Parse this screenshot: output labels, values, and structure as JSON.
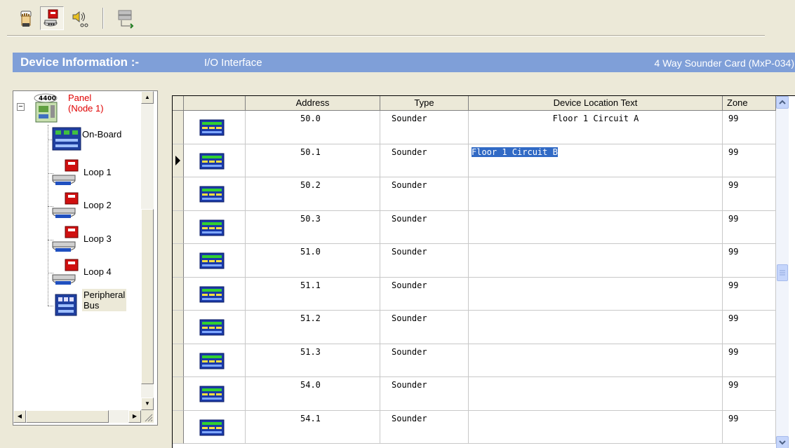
{
  "toolbar": {
    "buttons": [
      {
        "icon": "hand-device-icon"
      },
      {
        "icon": "sounder-device-icon",
        "pressed": true
      },
      {
        "icon": "speaker-icon"
      },
      {
        "icon": "network-config-icon"
      }
    ]
  },
  "device_header": {
    "title": "Device Information :-",
    "interface": "I/O Interface",
    "card": "4 Way Sounder Card (MxP-034)"
  },
  "tree": {
    "root": {
      "badge": "4400",
      "label_line1": "Panel",
      "label_line2": "(Node 1)",
      "expander": "−"
    },
    "items": [
      {
        "label": "On-Board",
        "icon": "onboard-board-icon"
      },
      {
        "label": "Loop 1",
        "icon": "loop-device-icon"
      },
      {
        "label": "Loop 2",
        "icon": "loop-device-icon"
      },
      {
        "label": "Loop 3",
        "icon": "loop-device-icon"
      },
      {
        "label": "Loop 4",
        "icon": "loop-device-icon"
      },
      {
        "label_line1": "Peripheral",
        "label_line2": "Bus",
        "icon": "peripheral-bus-icon",
        "selected": true
      }
    ]
  },
  "grid": {
    "columns": [
      "",
      "Address",
      "Type",
      "Device Location Text",
      "Zone"
    ],
    "current_row": 1,
    "rows": [
      {
        "address": "50.0",
        "type": "Sounder",
        "location": "Floor 1 Circuit A",
        "zone": "99"
      },
      {
        "address": "50.1",
        "type": "Sounder",
        "location": "Floor 1 Circuit B",
        "zone": "99"
      },
      {
        "address": "50.2",
        "type": "Sounder",
        "location": "",
        "zone": "99"
      },
      {
        "address": "50.3",
        "type": "Sounder",
        "location": "",
        "zone": "99"
      },
      {
        "address": "51.0",
        "type": "Sounder",
        "location": "",
        "zone": "99"
      },
      {
        "address": "51.1",
        "type": "Sounder",
        "location": "",
        "zone": "99"
      },
      {
        "address": "51.2",
        "type": "Sounder",
        "location": "",
        "zone": "99"
      },
      {
        "address": "51.3",
        "type": "Sounder",
        "location": "",
        "zone": "99"
      },
      {
        "address": "54.0",
        "type": "Sounder",
        "location": "",
        "zone": "99"
      },
      {
        "address": "54.1",
        "type": "Sounder",
        "location": "",
        "zone": "99"
      }
    ]
  },
  "colors": {
    "header_bar": "#7f9fd8",
    "selection": "#316ac5",
    "panel_label": "#e00000",
    "window_bg": "#ece9d8"
  }
}
